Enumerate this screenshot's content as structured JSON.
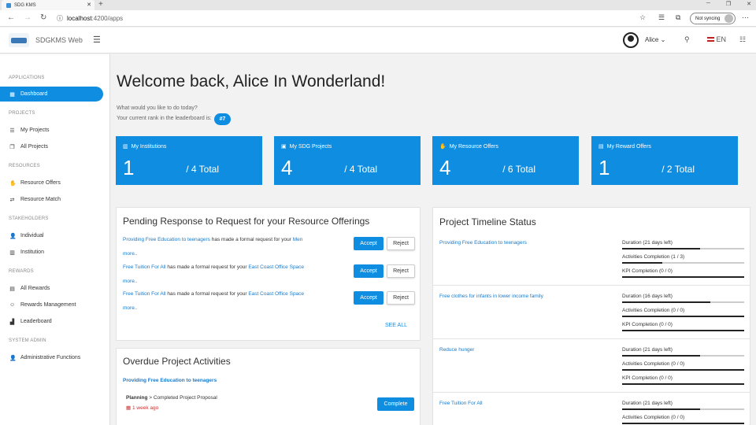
{
  "browser": {
    "tab_title": "SDG KMS",
    "url_host": "localhost",
    "url_path": ":4200/apps",
    "sync_label": "Not syncing"
  },
  "topbar": {
    "app_name": "SDGKMS Web",
    "user": "Alice",
    "lang": "EN"
  },
  "sidebar": {
    "sections": [
      "APPLICATIONS",
      "PROJECTS",
      "RESOURCES",
      "STAKEHOLDERS",
      "REWARDS",
      "SYSTEM ADMIN"
    ],
    "items": [
      {
        "label": "Dashboard",
        "icon": "dashboard-icon",
        "active": true
      },
      {
        "label": "My Projects",
        "icon": "list-icon"
      },
      {
        "label": "All Projects",
        "icon": "copy-icon"
      },
      {
        "label": "Resource Offers",
        "icon": "hand-icon"
      },
      {
        "label": "Resource Match",
        "icon": "shuffle-icon"
      },
      {
        "label": "Individual",
        "icon": "person-icon"
      },
      {
        "label": "Institution",
        "icon": "building-icon"
      },
      {
        "label": "All Rewards",
        "icon": "gift-icon"
      },
      {
        "label": "Rewards Management",
        "icon": "smile-icon"
      },
      {
        "label": "Leaderboard",
        "icon": "chart-icon"
      },
      {
        "label": "Administrative Functions",
        "icon": "person-icon"
      }
    ]
  },
  "main": {
    "welcome": "Welcome back, Alice In Wonderland!",
    "question": "What would you like to do today?",
    "rank_text": "Your current rank in the leaderboard is:",
    "rank": "#7",
    "cards": [
      {
        "title": "My Institutions",
        "value": "1",
        "total": "/ 4 Total",
        "icon": "building-icon"
      },
      {
        "title": "My SDG Projects",
        "value": "4",
        "total": "/ 4 Total",
        "icon": "folder-icon"
      },
      {
        "title": "My Resource Offers",
        "value": "4",
        "total": "/ 6 Total",
        "icon": "hand-icon"
      },
      {
        "title": "My Reward Offers",
        "value": "1",
        "total": "/ 2 Total",
        "icon": "gift-icon"
      }
    ]
  },
  "pending": {
    "title": "Pending Response to Request for your Resource Offerings",
    "accept": "Accept",
    "reject": "Reject",
    "more": "more..",
    "see_all": "SEE ALL",
    "requests": [
      {
        "project": "Providing Free Education to teenagers",
        "text": " has made a formal request for your ",
        "resource": "Men"
      },
      {
        "project": "Free Tuition For All",
        "text": " has made a formal request for your ",
        "resource": "East Coast Office Space"
      },
      {
        "project": "Free Tuition For All",
        "text": " has made a formal request for your ",
        "resource": "East Coast Office Space"
      }
    ]
  },
  "overdue": {
    "title": "Overdue Project Activities",
    "project": "Providing Free Education to teenagers",
    "activity_bold": "Planning",
    "activity_rest": " > Completed Project Proposal",
    "time": "1 week ago",
    "button": "Complete"
  },
  "timeline": {
    "title": "Project Timeline Status",
    "projects": [
      {
        "name": "Providing Free Education to teenagers",
        "metrics": [
          {
            "label": "Duration (21 days left)",
            "fill": 0.64
          },
          {
            "label": "Activities Completion (1 / 3)",
            "fill": 0.33
          },
          {
            "label": "KPI Completion (0 / 0)",
            "fill": 1
          }
        ]
      },
      {
        "name": "Free clothes for infants in lower income family",
        "metrics": [
          {
            "label": "Duration (16 days left)",
            "fill": 0.72
          },
          {
            "label": "Activities Completion (0 / 0)",
            "fill": 1
          },
          {
            "label": "KPI Completion (0 / 0)",
            "fill": 1
          }
        ]
      },
      {
        "name": "Reduce hunger",
        "metrics": [
          {
            "label": "Duration (21 days left)",
            "fill": 0.64
          },
          {
            "label": "Activities Completion (0 / 0)",
            "fill": 1
          },
          {
            "label": "KPI Completion (0 / 0)",
            "fill": 1
          }
        ]
      },
      {
        "name": "Free Tuition For All",
        "metrics": [
          {
            "label": "Duration (21 days left)",
            "fill": 0.64
          },
          {
            "label": "Activities Completion (0 / 0)",
            "fill": 1
          }
        ]
      }
    ]
  }
}
